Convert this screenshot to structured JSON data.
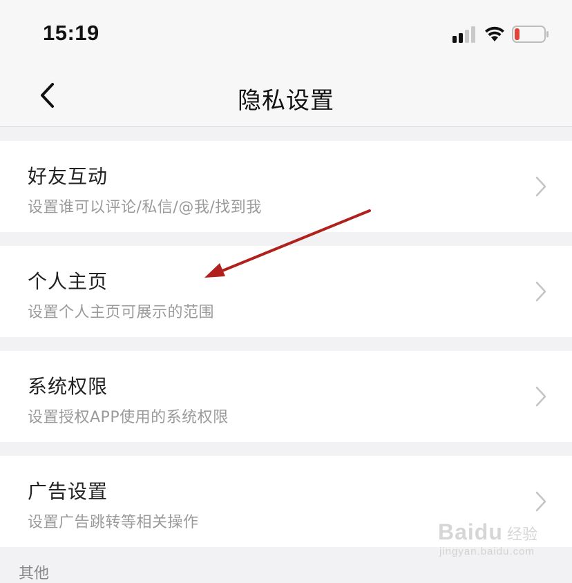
{
  "status_bar": {
    "time": "15:19",
    "battery_color": "#e0453a"
  },
  "nav": {
    "title": "隐私设置"
  },
  "items": [
    {
      "title": "好友互动",
      "desc": "设置谁可以评论/私信/@我/找到我"
    },
    {
      "title": "个人主页",
      "desc": "设置个人主页可展示的范围"
    },
    {
      "title": "系统权限",
      "desc": "设置授权APP使用的系统权限"
    },
    {
      "title": "广告设置",
      "desc": "设置广告跳转等相关操作"
    }
  ],
  "next_section": {
    "label": "其他"
  },
  "annotation": {
    "arrow_color": "#b0201c"
  },
  "watermark": {
    "brand": "Baidu",
    "sub": "经验",
    "url": "jingyan.baidu.com"
  }
}
